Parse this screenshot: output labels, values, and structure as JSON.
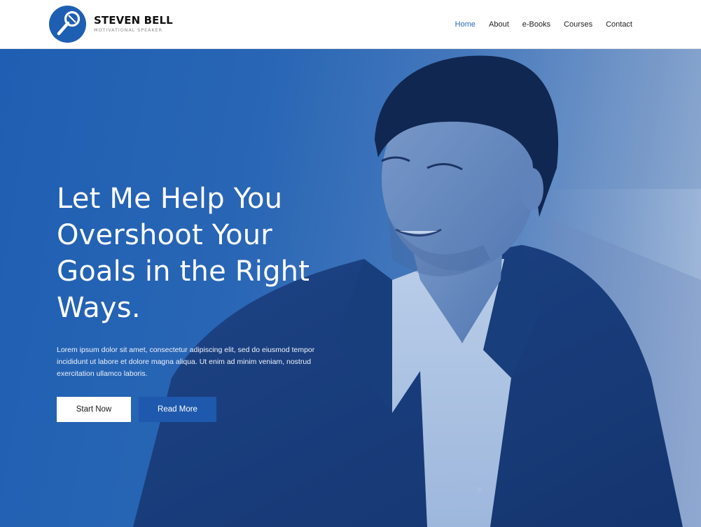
{
  "brand": {
    "name": "STEVEN BELL",
    "tagline": "MOTIVATIONAL SPEAKER"
  },
  "nav": {
    "items": [
      {
        "label": "Home",
        "active": true
      },
      {
        "label": "About",
        "active": false
      },
      {
        "label": "e-Books",
        "active": false
      },
      {
        "label": "Courses",
        "active": false
      },
      {
        "label": "Contact",
        "active": false
      }
    ]
  },
  "hero": {
    "title": "Let Me Help You Overshoot Your Goals in the Right Ways.",
    "text": "Lorem ipsum dolor sit amet, consectetur adipiscing elit, sed do eiusmod tempor incididunt ut labore et dolore magna aliqua. Ut enim ad minim veniam, nostrud exercitation ullamco laboris.",
    "primary_button": "Start Now",
    "secondary_button": "Read More"
  },
  "icons": {
    "logo": "microphone-icon",
    "hero_image": "speaker-portrait"
  },
  "colors": {
    "accent": "#2a6ab7",
    "hero_overlay": "#1f5fb3",
    "button_secondary": "#1f59ad"
  }
}
